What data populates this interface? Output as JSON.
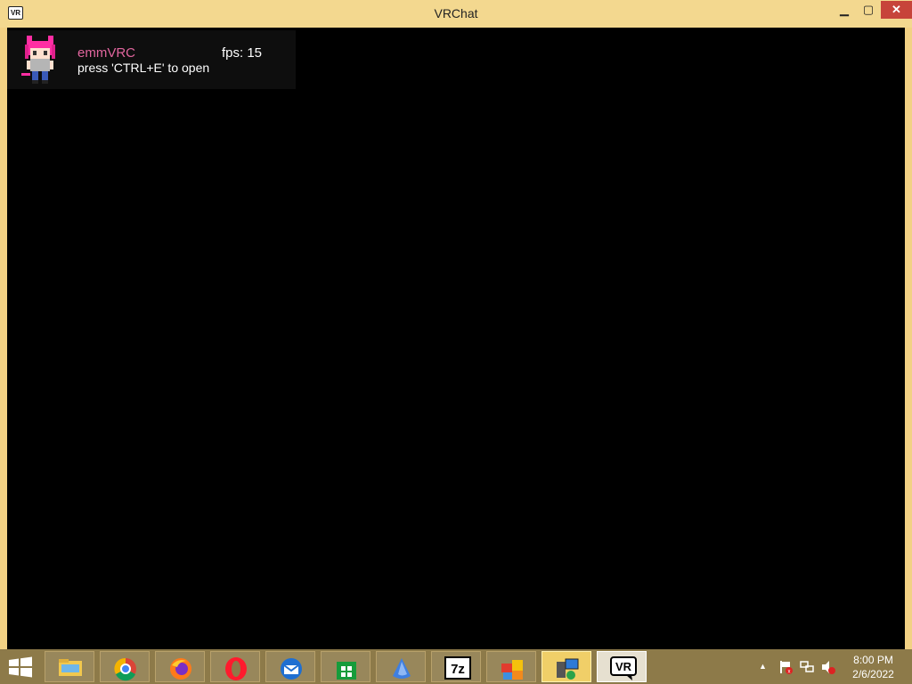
{
  "window": {
    "title": "VRChat",
    "icon_label": "VR",
    "minimize_glyph": "▁",
    "maximize_glyph": "▢",
    "close_glyph": "✕"
  },
  "overlay": {
    "name": "emmVRC",
    "fps": "fps: 15",
    "hint": "press 'CTRL+E' to open",
    "name_color": "#e2669f"
  },
  "taskbar": {
    "items": [
      {
        "name": "file-explorer-icon"
      },
      {
        "name": "chrome-icon"
      },
      {
        "name": "firefox-icon"
      },
      {
        "name": "opera-icon"
      },
      {
        "name": "thunderbird-icon"
      },
      {
        "name": "store-icon"
      },
      {
        "name": "drop-icon"
      },
      {
        "name": "7zip-icon",
        "label": "7z"
      },
      {
        "name": "control-panel-icon"
      },
      {
        "name": "network-app-icon"
      },
      {
        "name": "vrchat-icon",
        "label": "VR"
      }
    ],
    "tray": {
      "chevron": "▲",
      "time": "8:00 PM",
      "date": "2/6/2022"
    }
  },
  "colors": {
    "title_bg": "#f3d88f",
    "taskbar_bg": "#8d7a49",
    "client_bg": "#000000",
    "close_bg": "#c7443a"
  }
}
